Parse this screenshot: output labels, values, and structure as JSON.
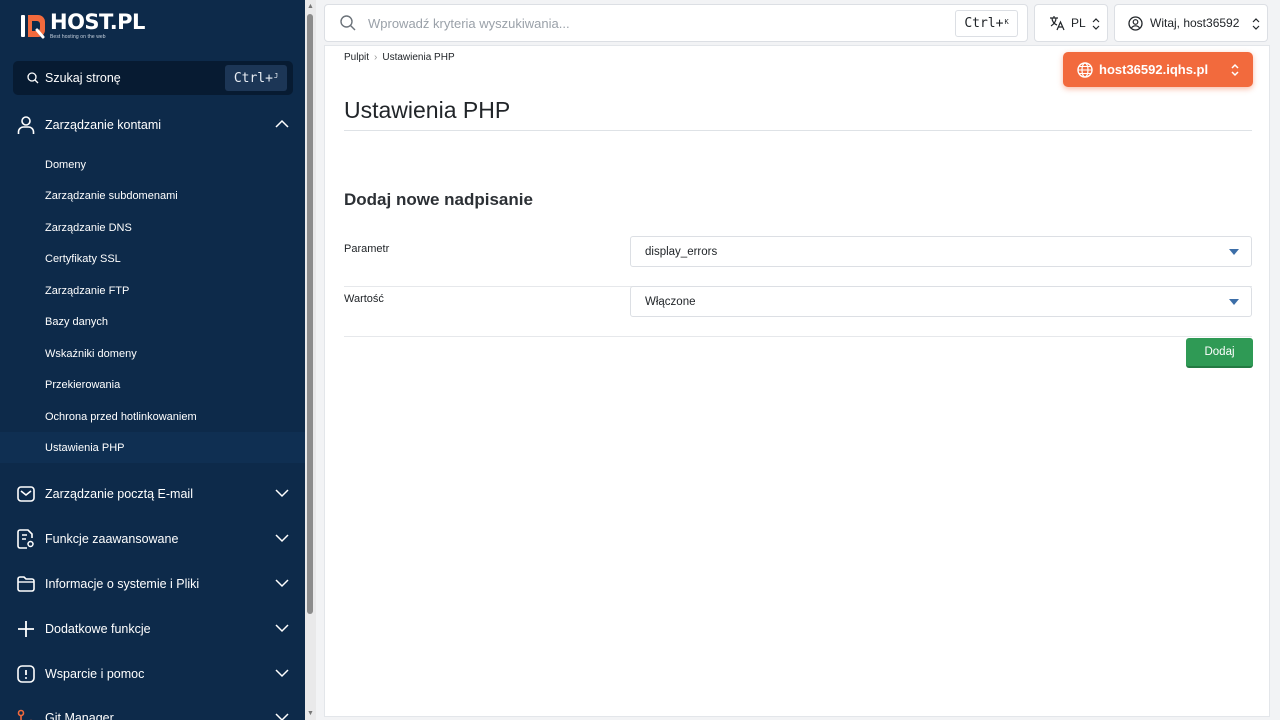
{
  "brand": {
    "name": "HOST.PL",
    "tagline": "Best hosting on the web"
  },
  "sidebar": {
    "search": {
      "label": "Szukaj stronę",
      "shortcut": "Ctrl+",
      "shortcut_key": "J"
    },
    "groups": [
      {
        "label": "Zarządzanie kontami",
        "icon": "user-icon",
        "expanded": true
      },
      {
        "label": "Zarządzanie pocztą E-mail",
        "icon": "mail-icon",
        "expanded": false
      },
      {
        "label": "Funkcje zaawansowane",
        "icon": "settings-doc-icon",
        "expanded": false
      },
      {
        "label": "Informacje o systemie i Pliki",
        "icon": "folder-icon",
        "expanded": false
      },
      {
        "label": "Dodatkowe funkcje",
        "icon": "plus-icon",
        "expanded": false
      },
      {
        "label": "Wsparcie i pomoc",
        "icon": "alert-icon",
        "expanded": false
      },
      {
        "label": "Git Manager",
        "icon": "git-icon",
        "expanded": false
      }
    ],
    "items": [
      {
        "label": "Domeny"
      },
      {
        "label": "Zarządzanie subdomenami"
      },
      {
        "label": "Zarządzanie DNS"
      },
      {
        "label": "Certyfikaty SSL"
      },
      {
        "label": "Zarządzanie FTP"
      },
      {
        "label": "Bazy danych"
      },
      {
        "label": "Wskaźniki domeny"
      },
      {
        "label": "Przekierowania"
      },
      {
        "label": "Ochrona przed hotlinkowaniem"
      },
      {
        "label": "Ustawienia PHP",
        "active": true
      }
    ]
  },
  "topbar": {
    "search_placeholder": "Wprowadź kryteria wyszukiwania...",
    "shortcut": "Ctrl+",
    "shortcut_key": "K",
    "language": "PL",
    "user": "Witaj, host36592"
  },
  "breadcrumb": {
    "home": "Pulpit",
    "current": "Ustawienia PHP"
  },
  "domain_selector": "host36592.iqhs.pl",
  "page": {
    "title": "Ustawienia PHP",
    "section_title": "Dodaj nowe nadpisanie",
    "form": {
      "param_label": "Parametr",
      "param_value": "display_errors",
      "value_label": "Wartość",
      "value_value": "Włączone",
      "submit": "Dodaj"
    }
  },
  "colors": {
    "sidebar": "#0d2a4a",
    "accent_orange": "#f26a3d",
    "submit_green": "#2f9a55",
    "caret_blue": "#3c6ea8"
  }
}
